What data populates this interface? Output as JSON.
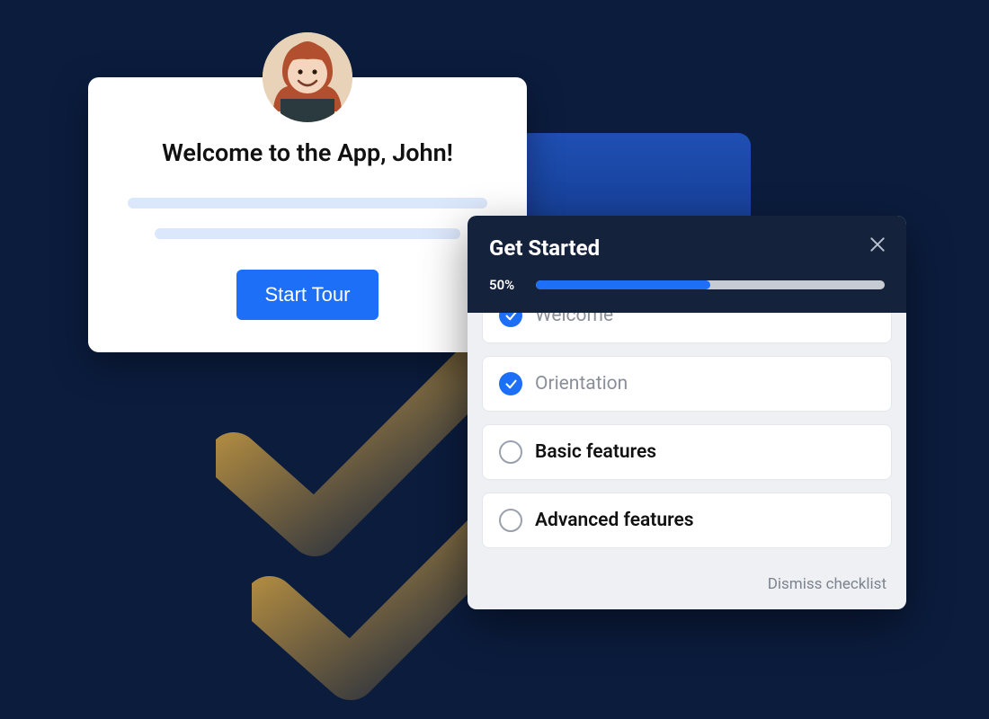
{
  "welcome": {
    "title": "Welcome to the App, John!",
    "cta": "Start Tour"
  },
  "checklist": {
    "title": "Get Started",
    "progress_label": "50%",
    "progress_value": 50,
    "items": [
      {
        "label": "Welcome",
        "done": true
      },
      {
        "label": "Orientation",
        "done": true
      },
      {
        "label": "Basic features",
        "done": false
      },
      {
        "label": "Advanced features",
        "done": false
      }
    ],
    "dismiss": "Dismiss checklist"
  },
  "colors": {
    "primary": "#1d6ff7",
    "bg": "#0b1c3d"
  }
}
